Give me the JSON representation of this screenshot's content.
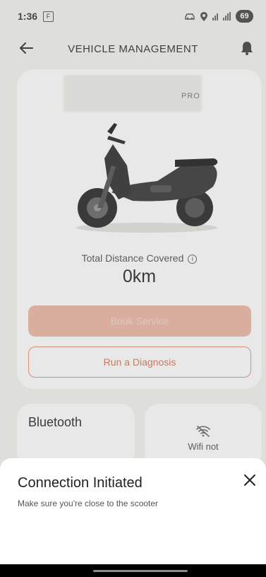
{
  "status_bar": {
    "time": "1:36",
    "f_icon_label": "F",
    "battery": "69"
  },
  "header": {
    "title": "VEHICLE MANAGEMENT"
  },
  "vehicle": {
    "badge_text": "PRO",
    "distance_label": "Total Distance Covered",
    "distance_value": "0km"
  },
  "actions": {
    "book_service": "Book Service",
    "run_diagnosis": "Run a Diagnosis"
  },
  "tiles": {
    "bluetooth": "Bluetooth",
    "wifi": "Wifi not"
  },
  "sheet": {
    "title": "Connection Initiated",
    "subtitle": "Make sure you're close to the scooter"
  },
  "colors": {
    "accent": "#e8967a",
    "accent_faded": "#f0b9a6"
  }
}
